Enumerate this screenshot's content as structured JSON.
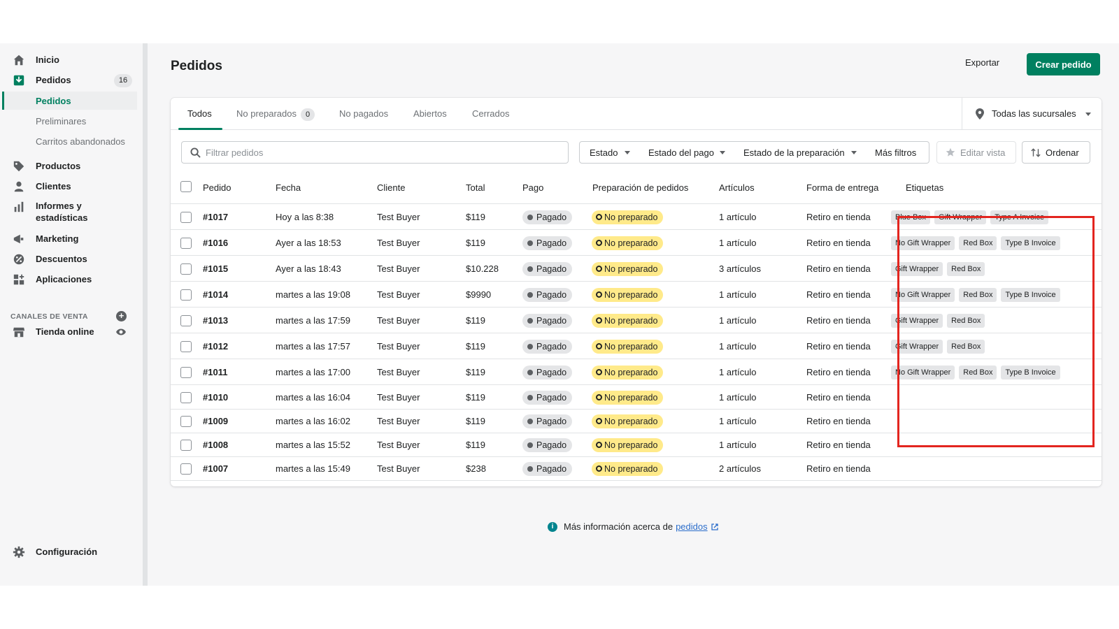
{
  "sidebar": {
    "items": [
      {
        "label": "Inicio",
        "icon": "home-icon"
      },
      {
        "label": "Pedidos",
        "icon": "orders-icon",
        "count": "16"
      },
      {
        "label": "Productos",
        "icon": "tag-icon"
      },
      {
        "label": "Clientes",
        "icon": "person-icon"
      },
      {
        "label": "Informes y estadísticas",
        "icon": "bar-chart-icon"
      },
      {
        "label": "Marketing",
        "icon": "megaphone-icon"
      },
      {
        "label": "Descuentos",
        "icon": "discount-icon"
      },
      {
        "label": "Aplicaciones",
        "icon": "apps-icon"
      }
    ],
    "subitems": [
      "Pedidos",
      "Preliminares",
      "Carritos abandonados"
    ],
    "sales_channels_title": "CANALES DE VENTA",
    "online_store": "Tienda online",
    "settings": "Configuración"
  },
  "header": {
    "title": "Pedidos",
    "export_label": "Exportar",
    "create_label": "Crear pedido"
  },
  "tabs": [
    {
      "label": "Todos"
    },
    {
      "label": "No preparados",
      "count": "0"
    },
    {
      "label": "No pagados"
    },
    {
      "label": "Abiertos"
    },
    {
      "label": "Cerrados"
    }
  ],
  "branch_selector": "Todas las sucursales",
  "filters": {
    "search_placeholder": "Filtrar pedidos",
    "estado": "Estado",
    "estado_pago": "Estado del pago",
    "estado_preparacion": "Estado de la preparación",
    "mas_filtros": "Más filtros",
    "editar_vista": "Editar vista",
    "ordenar": "Ordenar"
  },
  "table": {
    "columns": [
      "Pedido",
      "Fecha",
      "Cliente",
      "Total",
      "Pago",
      "Preparación de pedidos",
      "Artículos",
      "Forma de entrega",
      "Etiquetas"
    ],
    "rows": [
      {
        "id": "#1017",
        "date": "Hoy a las 8:38",
        "customer": "Test Buyer",
        "total": "$119",
        "payment": "Pagado",
        "fulfillment": "No preparado",
        "items": "1 artículo",
        "delivery": "Retiro en tienda",
        "tags": [
          "Blue Box",
          "Gift Wrapper",
          "Type A Invoice"
        ]
      },
      {
        "id": "#1016",
        "date": "Ayer a las 18:53",
        "customer": "Test Buyer",
        "total": "$119",
        "payment": "Pagado",
        "fulfillment": "No preparado",
        "items": "1 artículo",
        "delivery": "Retiro en tienda",
        "tags": [
          "No Gift Wrapper",
          "Red Box",
          "Type B Invoice"
        ]
      },
      {
        "id": "#1015",
        "date": "Ayer a las 18:43",
        "customer": "Test Buyer",
        "total": "$10.228",
        "payment": "Pagado",
        "fulfillment": "No preparado",
        "items": "3 artículos",
        "delivery": "Retiro en tienda",
        "tags": [
          "Gift Wrapper",
          "Red Box"
        ]
      },
      {
        "id": "#1014",
        "date": "martes a las 19:08",
        "customer": "Test Buyer",
        "total": "$9990",
        "payment": "Pagado",
        "fulfillment": "No preparado",
        "items": "1 artículo",
        "delivery": "Retiro en tienda",
        "tags": [
          "No Gift Wrapper",
          "Red Box",
          "Type B Invoice"
        ]
      },
      {
        "id": "#1013",
        "date": "martes a las 17:59",
        "customer": "Test Buyer",
        "total": "$119",
        "payment": "Pagado",
        "fulfillment": "No preparado",
        "items": "1 artículo",
        "delivery": "Retiro en tienda",
        "tags": [
          "Gift Wrapper",
          "Red Box"
        ]
      },
      {
        "id": "#1012",
        "date": "martes a las 17:57",
        "customer": "Test Buyer",
        "total": "$119",
        "payment": "Pagado",
        "fulfillment": "No preparado",
        "items": "1 artículo",
        "delivery": "Retiro en tienda",
        "tags": [
          "Gift Wrapper",
          "Red Box"
        ]
      },
      {
        "id": "#1011",
        "date": "martes a las 17:00",
        "customer": "Test Buyer",
        "total": "$119",
        "payment": "Pagado",
        "fulfillment": "No preparado",
        "items": "1 artículo",
        "delivery": "Retiro en tienda",
        "tags": [
          "No Gift Wrapper",
          "Red Box",
          "Type B Invoice"
        ]
      },
      {
        "id": "#1010",
        "date": "martes a las 16:04",
        "customer": "Test Buyer",
        "total": "$119",
        "payment": "Pagado",
        "fulfillment": "No preparado",
        "items": "1 artículo",
        "delivery": "Retiro en tienda",
        "tags": []
      },
      {
        "id": "#1009",
        "date": "martes a las 16:02",
        "customer": "Test Buyer",
        "total": "$119",
        "payment": "Pagado",
        "fulfillment": "No preparado",
        "items": "1 artículo",
        "delivery": "Retiro en tienda",
        "tags": []
      },
      {
        "id": "#1008",
        "date": "martes a las 15:52",
        "customer": "Test Buyer",
        "total": "$119",
        "payment": "Pagado",
        "fulfillment": "No preparado",
        "items": "1 artículo",
        "delivery": "Retiro en tienda",
        "tags": []
      },
      {
        "id": "#1007",
        "date": "martes a las 15:49",
        "customer": "Test Buyer",
        "total": "$238",
        "payment": "Pagado",
        "fulfillment": "No preparado",
        "items": "2 artículos",
        "delivery": "Retiro en tienda",
        "tags": []
      }
    ]
  },
  "footer": {
    "info_text": "Más información acerca de",
    "info_link": "pedidos"
  },
  "colors": {
    "primary": "#008060",
    "highlight": "#e3251f",
    "unfulfilled": "#ffea8a",
    "link": "#2c6ecb"
  }
}
